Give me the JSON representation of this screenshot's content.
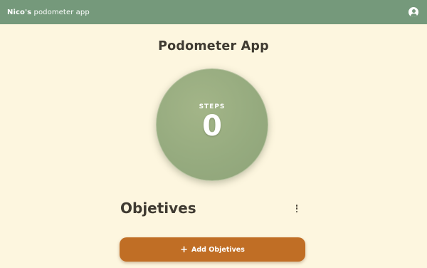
{
  "header": {
    "brand_bold": "Nico's",
    "brand_rest": " podometer app",
    "account_icon": "account-circle-icon",
    "background_color": "#75997b"
  },
  "main": {
    "title": "Podometer App",
    "steps": {
      "label": "STEPS",
      "value": "0"
    }
  },
  "objectives": {
    "title": "Objetives",
    "menu_icon": "more-vertical-icon",
    "add_button": {
      "icon": "plus-icon",
      "icon_glyph": "+",
      "label": "Add Objetives",
      "color": "#c06e25"
    }
  },
  "colors": {
    "page_background": "#fdf6df",
    "circle": "#96ab7f"
  }
}
